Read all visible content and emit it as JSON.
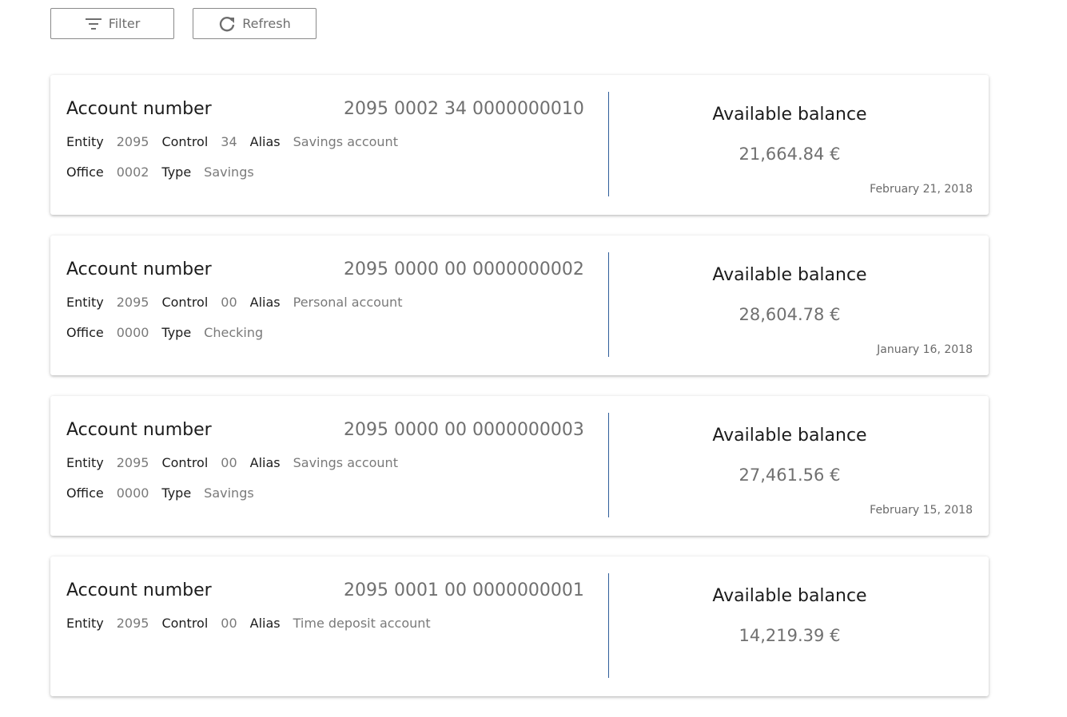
{
  "toolbar": {
    "filter_label": "Filter",
    "refresh_label": "Refresh"
  },
  "labels": {
    "account_number": "Account number",
    "entity": "Entity",
    "control": "Control",
    "alias": "Alias",
    "office": "Office",
    "type": "Type",
    "available_balance": "Available balance"
  },
  "accounts": [
    {
      "number": "2095 0002 34 0000000010",
      "entity": "2095",
      "control": "34",
      "alias": "Savings account",
      "office": "0002",
      "type": "Savings",
      "balance": "21,664.84 €",
      "date": "February 21, 2018"
    },
    {
      "number": "2095 0000 00 0000000002",
      "entity": "2095",
      "control": "00",
      "alias": "Personal account",
      "office": "0000",
      "type": "Checking",
      "balance": "28,604.78 €",
      "date": "January 16, 2018"
    },
    {
      "number": "2095 0000 00 0000000003",
      "entity": "2095",
      "control": "00",
      "alias": "Savings account",
      "office": "0000",
      "type": "Savings",
      "balance": "27,461.56 €",
      "date": "February 15, 2018"
    },
    {
      "number": "2095 0001 00 0000000001",
      "entity": "2095",
      "control": "00",
      "alias": "Time deposit account",
      "office": "",
      "type": "",
      "balance": "14,219.39 €",
      "date": ""
    }
  ],
  "colors": {
    "divider": "#2f5d9a",
    "muted_text": "#707070"
  },
  "icons": {
    "filter": "filter-icon",
    "refresh": "refresh-icon"
  }
}
